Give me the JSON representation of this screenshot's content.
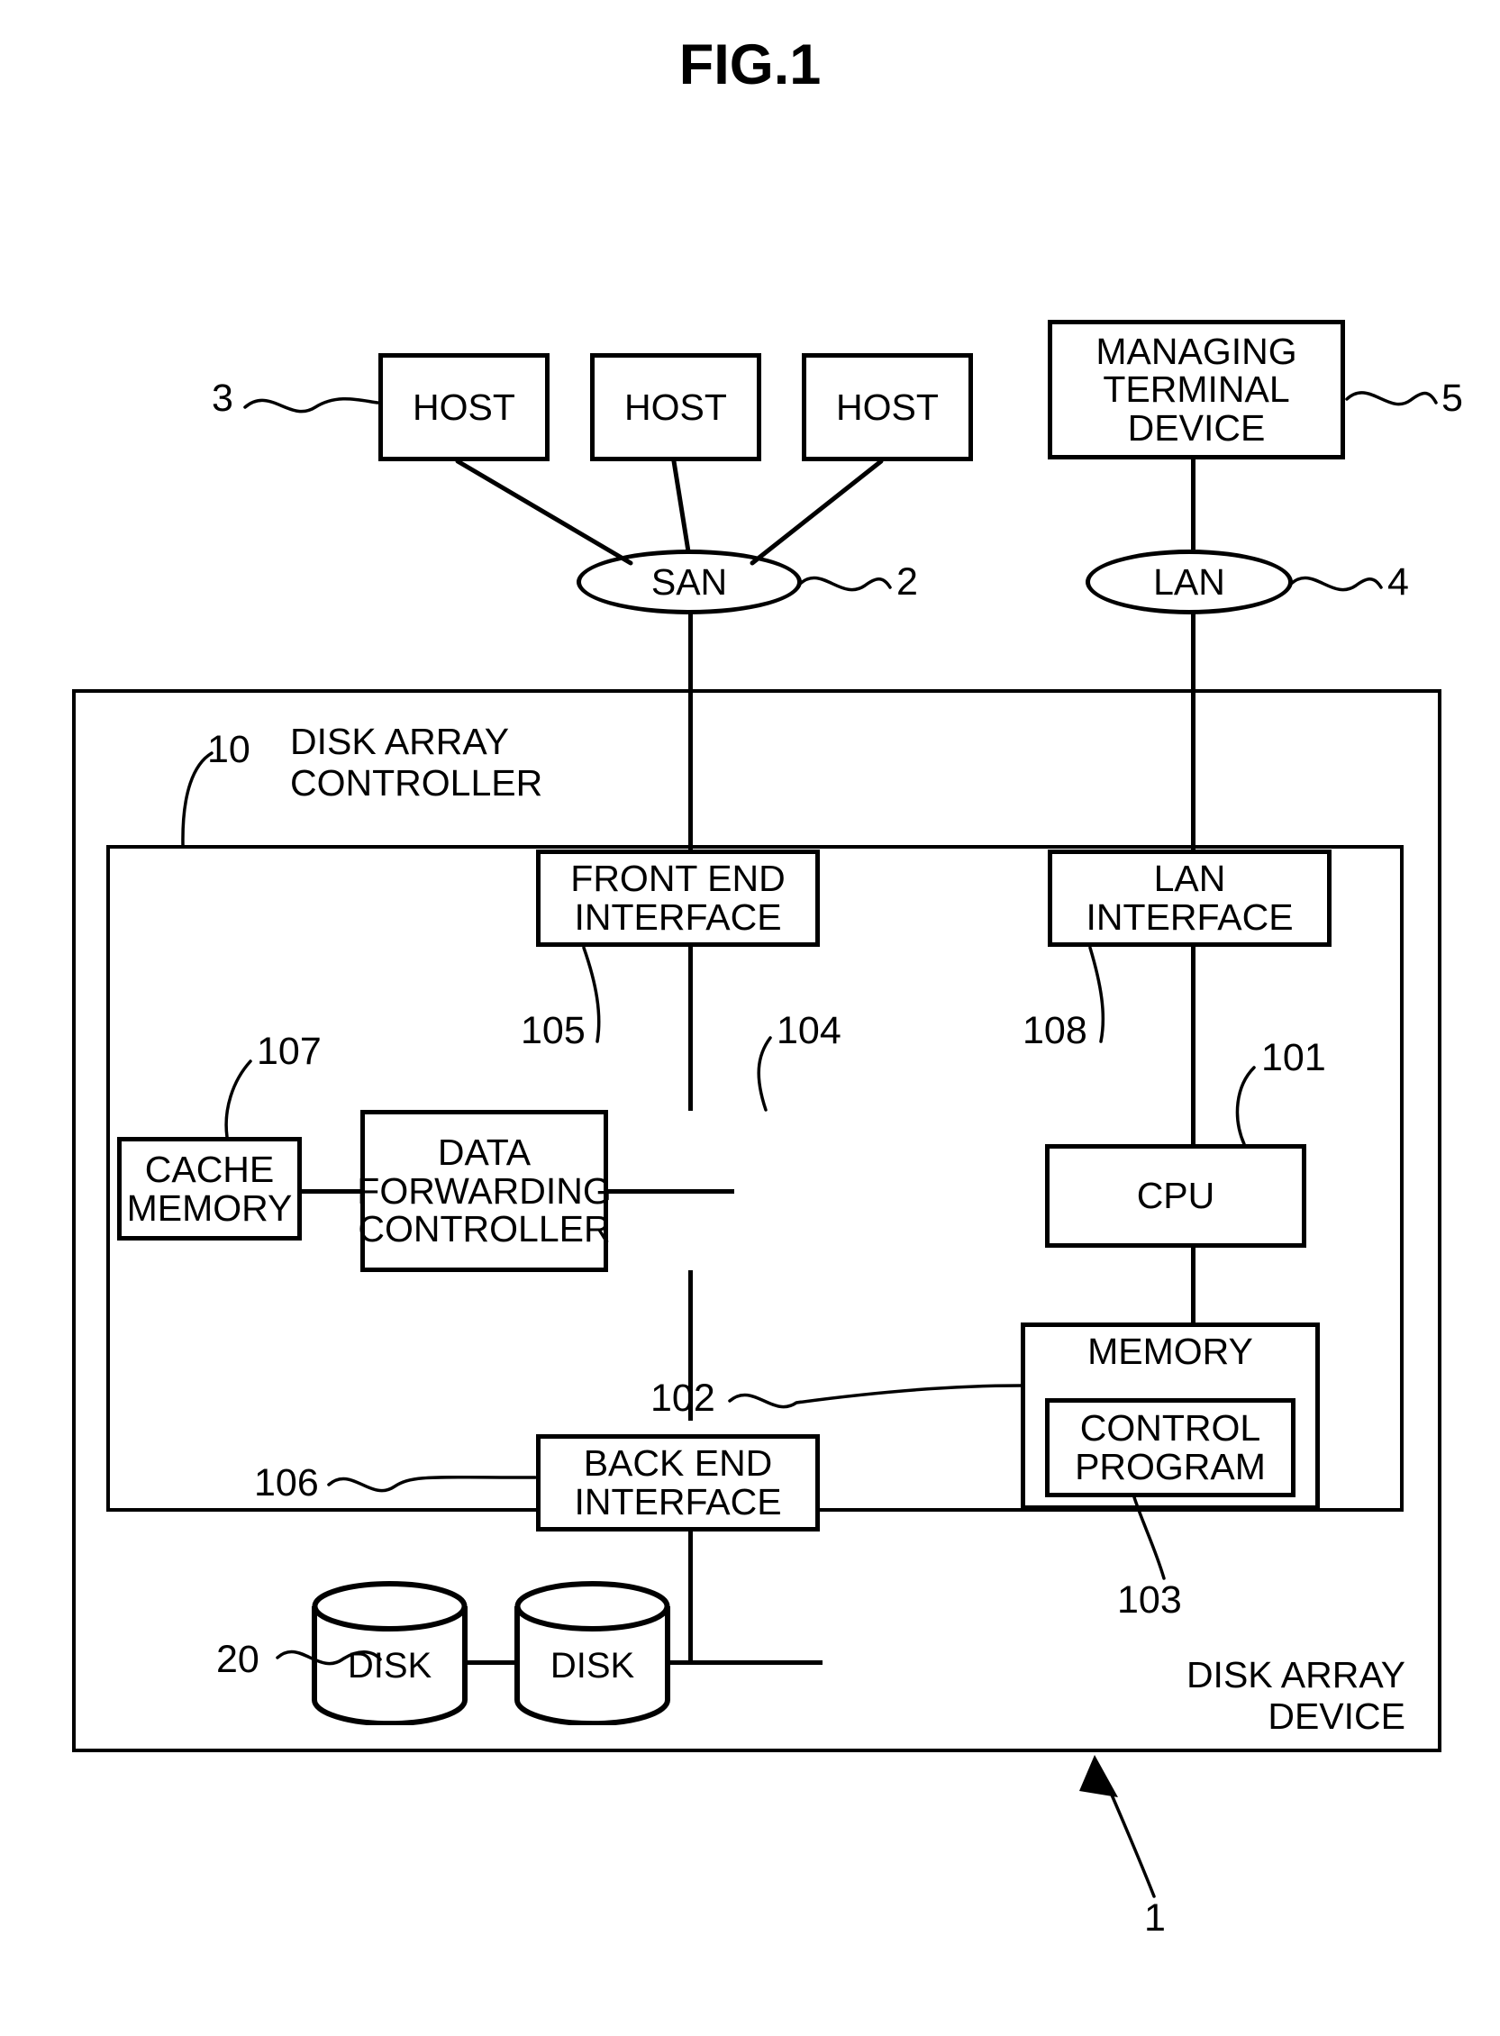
{
  "figure": {
    "title": "FIG.1"
  },
  "hosts": [
    {
      "label": "HOST",
      "ref": "3"
    },
    {
      "label": "HOST"
    },
    {
      "label": "HOST"
    }
  ],
  "managing_terminal": {
    "label": "MANAGING\nTERMINAL\nDEVICE",
    "line1": "MANAGING",
    "line2": "TERMINAL",
    "line3": "DEVICE",
    "ref": "5"
  },
  "networks": {
    "san": {
      "label": "SAN",
      "ref": "2"
    },
    "lan": {
      "label": "LAN",
      "ref": "4"
    }
  },
  "disk_array_device": {
    "label_line1": "DISK ARRAY",
    "label_line2": "DEVICE",
    "ref": "1"
  },
  "disk_array_controller": {
    "ref": "10",
    "label_line1": "DISK ARRAY",
    "label_line2": "CONTROLLER"
  },
  "components": {
    "front_end_interface": {
      "line1": "FRONT END",
      "line2": "INTERFACE",
      "ref": "105"
    },
    "lan_interface": {
      "line1": "LAN",
      "line2": "INTERFACE",
      "ref": "108"
    },
    "cache_memory": {
      "line1": "CACHE",
      "line2": "MEMORY",
      "ref": "107"
    },
    "data_forwarding_controller": {
      "line1": "DATA",
      "line2": "FORWARDING",
      "line3": "CONTROLLER",
      "ref": "104"
    },
    "cpu": {
      "label": "CPU",
      "ref": "101"
    },
    "memory": {
      "label": "MEMORY",
      "ref": "102"
    },
    "control_program": {
      "line1": "CONTROL",
      "line2": "PROGRAM",
      "ref": "103"
    },
    "back_end_interface": {
      "line1": "BACK END",
      "line2": "INTERFACE",
      "ref": "106"
    }
  },
  "disks": {
    "ref": "20",
    "items": [
      {
        "label": "DISK"
      },
      {
        "label": "DISK"
      }
    ]
  },
  "colors": {
    "stroke": "#000000",
    "background": "#ffffff"
  }
}
